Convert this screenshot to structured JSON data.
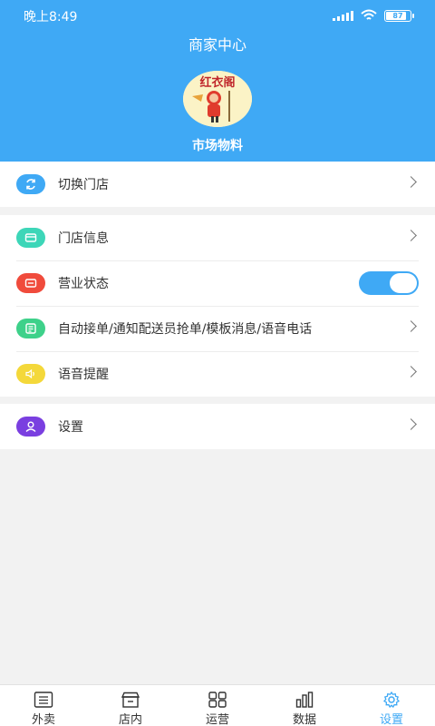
{
  "status_bar": {
    "time": "晚上8:49",
    "battery": "87"
  },
  "header": {
    "title": "商家中心",
    "store_name": "市场物料",
    "avatar_text": "红衣阁"
  },
  "switch_store": {
    "label": "切换门店"
  },
  "menu": {
    "store_info": "门店信息",
    "business_status": "营业状态",
    "auto_order": "自动接单/通知配送员抢单/模板消息/语音电话",
    "voice_reminder": "语音提醒"
  },
  "settings": {
    "label": "设置"
  },
  "tabs": [
    {
      "label": "外卖",
      "icon": "list-icon"
    },
    {
      "label": "店内",
      "icon": "store-icon"
    },
    {
      "label": "运营",
      "icon": "grid-icon"
    },
    {
      "label": "数据",
      "icon": "bar-chart-icon"
    },
    {
      "label": "设置",
      "icon": "gear-icon"
    }
  ],
  "colors": {
    "primary": "#3fa9f5",
    "switch_icon": "#3fa9f5",
    "store_info_icon": "#3dd6b8",
    "business_status_icon": "#f04b3c",
    "auto_order_icon": "#3ed18a",
    "voice_icon": "#f4d83a",
    "settings_icon": "#7a3fe0"
  },
  "business_status_on": true
}
